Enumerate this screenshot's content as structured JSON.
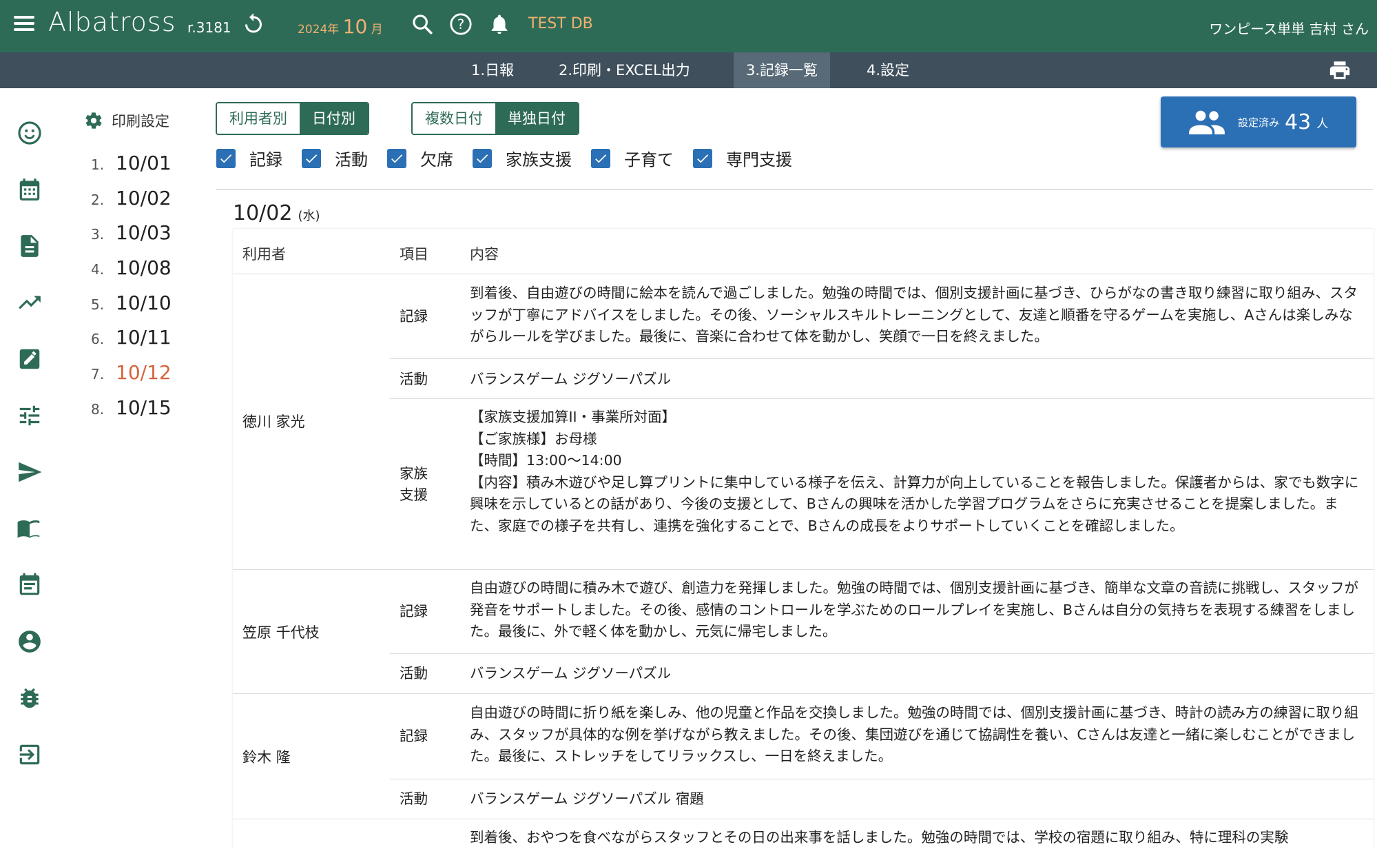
{
  "app": {
    "brand": "Albatross",
    "version": "r.3181",
    "year": "2024年",
    "month": "10",
    "month_suffix": "月",
    "db": "TEST DB",
    "user": "ワンピース単単 吉村 さん"
  },
  "nav": {
    "tabs": [
      {
        "label": "1.日報"
      },
      {
        "label": "2.印刷・EXCEL出力"
      },
      {
        "label": "3.記録一覧"
      },
      {
        "label": "4.設定"
      }
    ]
  },
  "print_settings": "印刷設定",
  "dates": [
    {
      "num": "1.",
      "date": "10/01"
    },
    {
      "num": "2.",
      "date": "10/02"
    },
    {
      "num": "3.",
      "date": "10/03"
    },
    {
      "num": "4.",
      "date": "10/08"
    },
    {
      "num": "5.",
      "date": "10/10"
    },
    {
      "num": "6.",
      "date": "10/11"
    },
    {
      "num": "7.",
      "date": "10/12"
    },
    {
      "num": "8.",
      "date": "10/15"
    }
  ],
  "toggles": {
    "group1": [
      "利用者別",
      "日付別"
    ],
    "group2": [
      "複数日付",
      "単独日付"
    ]
  },
  "filters": [
    "記録",
    "活動",
    "欠席",
    "家族支援",
    "子育て",
    "専門支援"
  ],
  "users_button": {
    "label": "設定済み",
    "count": "43",
    "unit": "人"
  },
  "day": {
    "date": "10/02",
    "dow": "(水)"
  },
  "table": {
    "headers": [
      "利用者",
      "項目",
      "内容"
    ],
    "rows": [
      {
        "user": "徳川 家光",
        "item1": "記録",
        "content1": "到着後、自由遊びの時間に絵本を読んで過ごしました。勉強の時間では、個別支援計画に基づき、ひらがなの書き取り練習に取り組み、スタッフが丁寧にアドバイスをしました。その後、ソーシャルスキルトレーニングとして、友達と順番を守るゲームを実施し、Aさんは楽しみながらルールを学びました。最後に、音楽に合わせて体を動かし、笑顔で一日を終えました。",
        "item2": "活動",
        "content2": "バランスゲーム ジグソーパズル",
        "item3a": "家族",
        "item3b": "支援",
        "content3": "【家族支援加算II・事業所対面】\n【ご家族様】お母様\n【時間】13:00〜14:00\n【内容】積み木遊びや足し算プリントに集中している様子を伝え、計算力が向上していることを報告しました。保護者からは、家でも数字に興味を示しているとの話があり、今後の支援として、Bさんの興味を活かした学習プログラムをさらに充実させることを提案しました。また、家庭での様子を共有し、連携を強化することで、Bさんの成長をよりサポートしていくことを確認しました。"
      },
      {
        "user": "笠原 千代枝",
        "item1": "記録",
        "content1": "自由遊びの時間に積み木で遊び、創造力を発揮しました。勉強の時間では、個別支援計画に基づき、簡単な文章の音読に挑戦し、スタッフが発音をサポートしました。その後、感情のコントロールを学ぶためのロールプレイを実施し、Bさんは自分の気持ちを表現する練習をしました。最後に、外で軽く体を動かし、元気に帰宅しました。",
        "item2": "活動",
        "content2": "バランスゲーム ジグソーパズル"
      },
      {
        "user": "鈴木 隆",
        "item1": "記録",
        "content1": "自由遊びの時間に折り紙を楽しみ、他の児童と作品を交換しました。勉強の時間では、個別支援計画に基づき、時計の読み方の練習に取り組み、スタッフが具体的な例を挙げながら教えました。その後、集団遊びを通じて協調性を養い、Cさんは友達と一緒に楽しむことができました。最後に、ストレッチをしてリラックスし、一日を終えました。",
        "item2": "活動",
        "content2": "バランスゲーム ジグソーパズル 宿題"
      },
      {
        "content1": "到着後、おやつを食べながらスタッフとその日の出来事を話しました。勉強の時間では、学校の宿題に取り組み、特に理科の実験"
      }
    ]
  }
}
